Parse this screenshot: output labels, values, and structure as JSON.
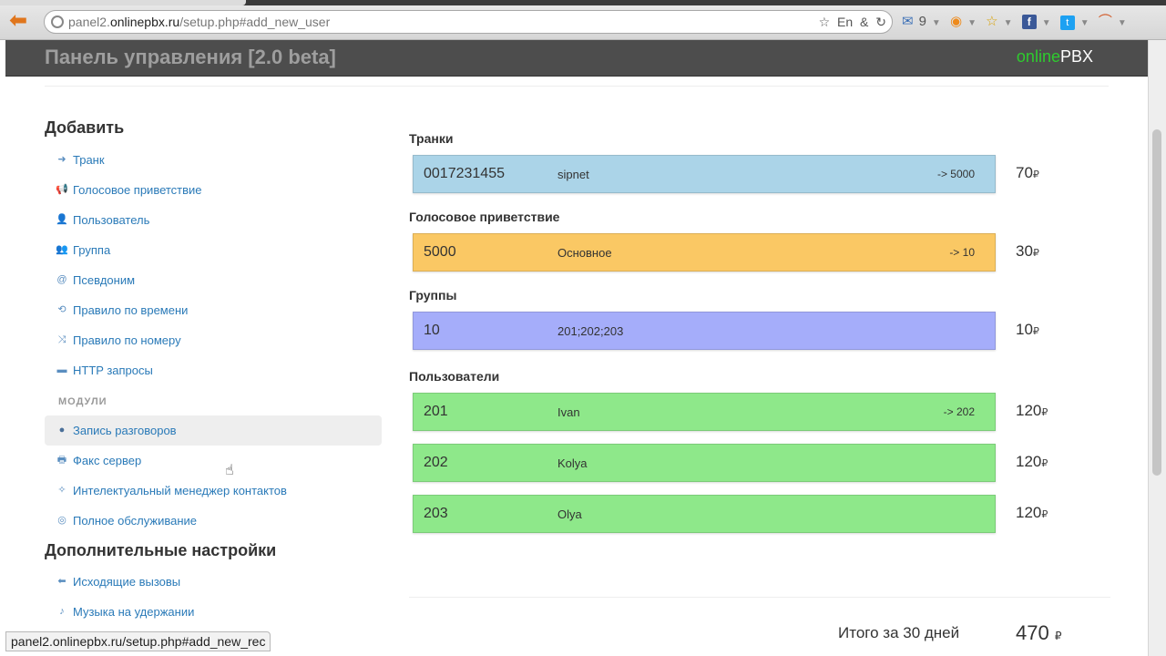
{
  "browser": {
    "url_prefix": "panel2.",
    "url_host": "onlinepbx.ru",
    "url_path": "/setup.php#add_new_user",
    "url_icons": [
      "☆",
      "En",
      "&",
      "↻"
    ],
    "mail_count": "9",
    "status_url": "panel2.onlinepbx.ru/setup.php#add_new_rec"
  },
  "header": {
    "title": "Панель управления [2.0 beta]",
    "logo_part1": "online",
    "logo_part2": "PBX"
  },
  "sidebar": {
    "add_heading": "Добавить",
    "add_items": [
      {
        "label": "Транк",
        "icon": "arrow-right-icon",
        "glyph": "➜"
      },
      {
        "label": "Голосовое приветствие",
        "icon": "megaphone-icon",
        "glyph": "📢"
      },
      {
        "label": "Пользователь",
        "icon": "user-plus-icon",
        "glyph": "👤"
      },
      {
        "label": "Группа",
        "icon": "users-icon",
        "glyph": "👥"
      },
      {
        "label": "Псевдоним",
        "icon": "at-icon",
        "glyph": "@"
      },
      {
        "label": "Правило по времени",
        "icon": "history-icon",
        "glyph": "⟲"
      },
      {
        "label": "Правило по номеру",
        "icon": "shuffle-icon",
        "glyph": "⤨"
      },
      {
        "label": "HTTP запросы",
        "icon": "terminal-icon",
        "glyph": "▬"
      }
    ],
    "modules_heading": "МОДУЛИ",
    "module_items": [
      {
        "label": "Запись разговоров",
        "icon": "record-icon",
        "glyph": "●"
      },
      {
        "label": "Факс сервер",
        "icon": "printer-icon",
        "glyph": "🖶"
      },
      {
        "label": "Интелектуальный менеджер контактов",
        "icon": "magic-icon",
        "glyph": "✧"
      },
      {
        "label": "Полное обслуживание",
        "icon": "lifebuoy-icon",
        "glyph": "◎"
      }
    ],
    "extra_heading": "Дополнительные настройки",
    "extra_items": [
      {
        "label": "Исходящие вызовы",
        "icon": "arrow-left-icon",
        "glyph": "⬅"
      },
      {
        "label": "Музыка на удержании",
        "icon": "music-icon",
        "glyph": "♪"
      }
    ]
  },
  "main": {
    "sections": [
      {
        "title": "Транки",
        "color": "#abd4e8",
        "rows": [
          {
            "number": "0017231455",
            "name": "sipnet",
            "target": "-> 5000",
            "price": "70"
          }
        ]
      },
      {
        "title": "Голосовое приветствие",
        "color": "#fac864",
        "rows": [
          {
            "number": "5000",
            "name": "Основное",
            "target": "-> 10",
            "price": "30"
          }
        ]
      },
      {
        "title": "Группы",
        "color": "#a5adfa",
        "rows": [
          {
            "number": "10",
            "name": "201;202;203",
            "target": "",
            "price": "10"
          }
        ]
      },
      {
        "title": "Пользователи",
        "color": "#8ee88a",
        "rows": [
          {
            "number": "201",
            "name": "Ivan",
            "target": "-> 202",
            "price": "120"
          },
          {
            "number": "202",
            "name": "Kolya",
            "target": "",
            "price": "120"
          },
          {
            "number": "203",
            "name": "Olya",
            "target": "",
            "price": "120"
          }
        ]
      }
    ],
    "currency": "₽",
    "total_label": "Итого за 30 дней",
    "total_value": "470"
  },
  "colors": {
    "header_bg": "#4d4d4d",
    "link": "#2a7ab8",
    "logo_green": "#2ecc2e"
  }
}
